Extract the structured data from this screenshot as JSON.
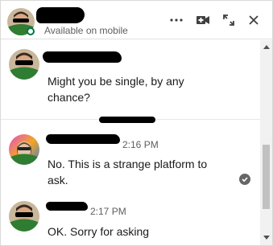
{
  "header": {
    "status": "Available on mobile",
    "icons": {
      "more": "more-horizontal-icon",
      "video": "video-call-icon",
      "expand": "expand-icon",
      "close": "close-icon"
    },
    "presence_color": "#057642"
  },
  "messages": [
    {
      "time": "",
      "text": "Might you be single, by any chance?"
    },
    {
      "time": "2:16 PM",
      "text": "No. This is a strange platform to ask."
    },
    {
      "time": "2:17 PM",
      "text": "OK. Sorry for asking"
    }
  ],
  "read_receipt_icon": "check-circle-icon",
  "colors": {
    "text": "#191919",
    "secondary_text": "#5e5e5e",
    "badge_green": "#2e7d32"
  }
}
